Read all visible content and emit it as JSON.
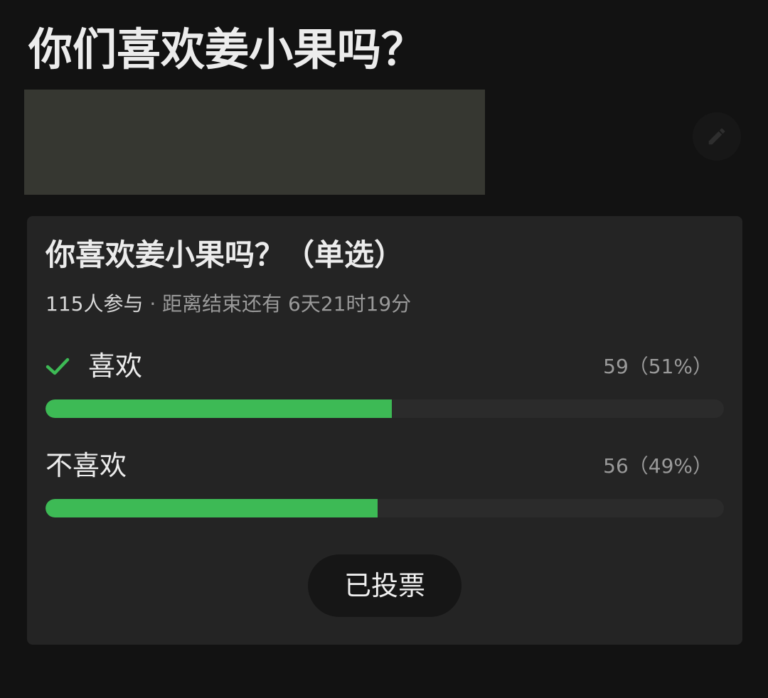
{
  "page": {
    "title": "你们喜欢姜小果吗？"
  },
  "edit_button": {
    "icon": "pencil-icon"
  },
  "poll": {
    "title": "你喜欢姜小果吗？（单选）",
    "participants": "115人参与",
    "separator": " · ",
    "time_remaining": "距离结束还有 6天21时19分",
    "options": [
      {
        "label": "喜欢",
        "count_text": "59（51%）",
        "votes": 59,
        "percent": 51,
        "selected": true,
        "selected_icon": "check-icon"
      },
      {
        "label": "不喜欢",
        "count_text": "56（49%）",
        "votes": 56,
        "percent": 49,
        "selected": false
      }
    ],
    "voted_label": "已投票"
  },
  "colors": {
    "background": "#121212",
    "card": "#242424",
    "accent_green": "#3dba55",
    "image_placeholder": "#363731"
  }
}
